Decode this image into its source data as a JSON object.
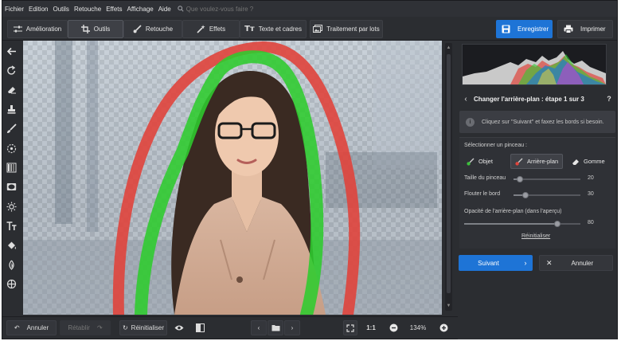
{
  "menu": {
    "items": [
      "Fichier",
      "Edition",
      "Outils",
      "Retouche",
      "Effets",
      "Affichage",
      "Aide"
    ],
    "search_placeholder": "Que voulez-vous faire ?"
  },
  "tabs": [
    {
      "label": "Amélioration",
      "icon": "sliders-icon"
    },
    {
      "label": "Outils",
      "icon": "crop-icon",
      "active": true
    },
    {
      "label": "Retouche",
      "icon": "brush-icon"
    },
    {
      "label": "Effets",
      "icon": "magic-wand-icon"
    },
    {
      "label": "Texte et cadres",
      "icon": "text-icon"
    },
    {
      "label": "Traitement par lots",
      "icon": "image-stack-icon"
    }
  ],
  "actions": {
    "save_label": "Enregistrer",
    "print_label": "Imprimer"
  },
  "left_tools": [
    "back-arrow-icon",
    "rotate-icon",
    "eraser-icon",
    "stamp-icon",
    "brush-icon",
    "circle-target-icon",
    "gradient-icon",
    "vignette-icon",
    "sun-icon",
    "text-tt-icon",
    "paint-bucket-icon",
    "color-drop-icon",
    "crosshair-icon"
  ],
  "bottom": {
    "undo_label": "Annuler",
    "redo_label": "Rétablir",
    "reset_label": "Réinitialiser",
    "zoom_one": "1:1",
    "zoom_value": "134%"
  },
  "panel": {
    "step_title": "Changer l'arrière-plan : étape 1 sur 3",
    "help": "?",
    "hint": "Cliquez sur \"Suivant\" et faxez les bords si besoin.",
    "brush_select_label": "Sélectionner un pinceau :",
    "brushes": [
      {
        "label": "Objet",
        "icon": "object-brush-icon",
        "color": "#3bbf3b"
      },
      {
        "label": "Arrière-plan",
        "icon": "background-brush-icon",
        "color": "#e0443c",
        "selected": true
      },
      {
        "label": "Gomme",
        "icon": "eraser-icon",
        "color": "#e6e6e6"
      }
    ],
    "sliders": [
      {
        "label": "Taille du pinceau",
        "value": "20",
        "fraction": 0.1
      },
      {
        "label": "Flouter le bord",
        "value": "30",
        "fraction": 0.18
      },
      {
        "label": "Opacité de l'arrière-plan (dans l'aperçu)",
        "value": "80",
        "fraction": 0.8
      }
    ],
    "reset_link": "Réinitialiser",
    "next_label": "Suivant",
    "cancel_label": "Annuler"
  },
  "colors": {
    "accent": "#1e74d6",
    "object_stroke": "#2ecc2e",
    "background_stroke": "#e0443c"
  }
}
